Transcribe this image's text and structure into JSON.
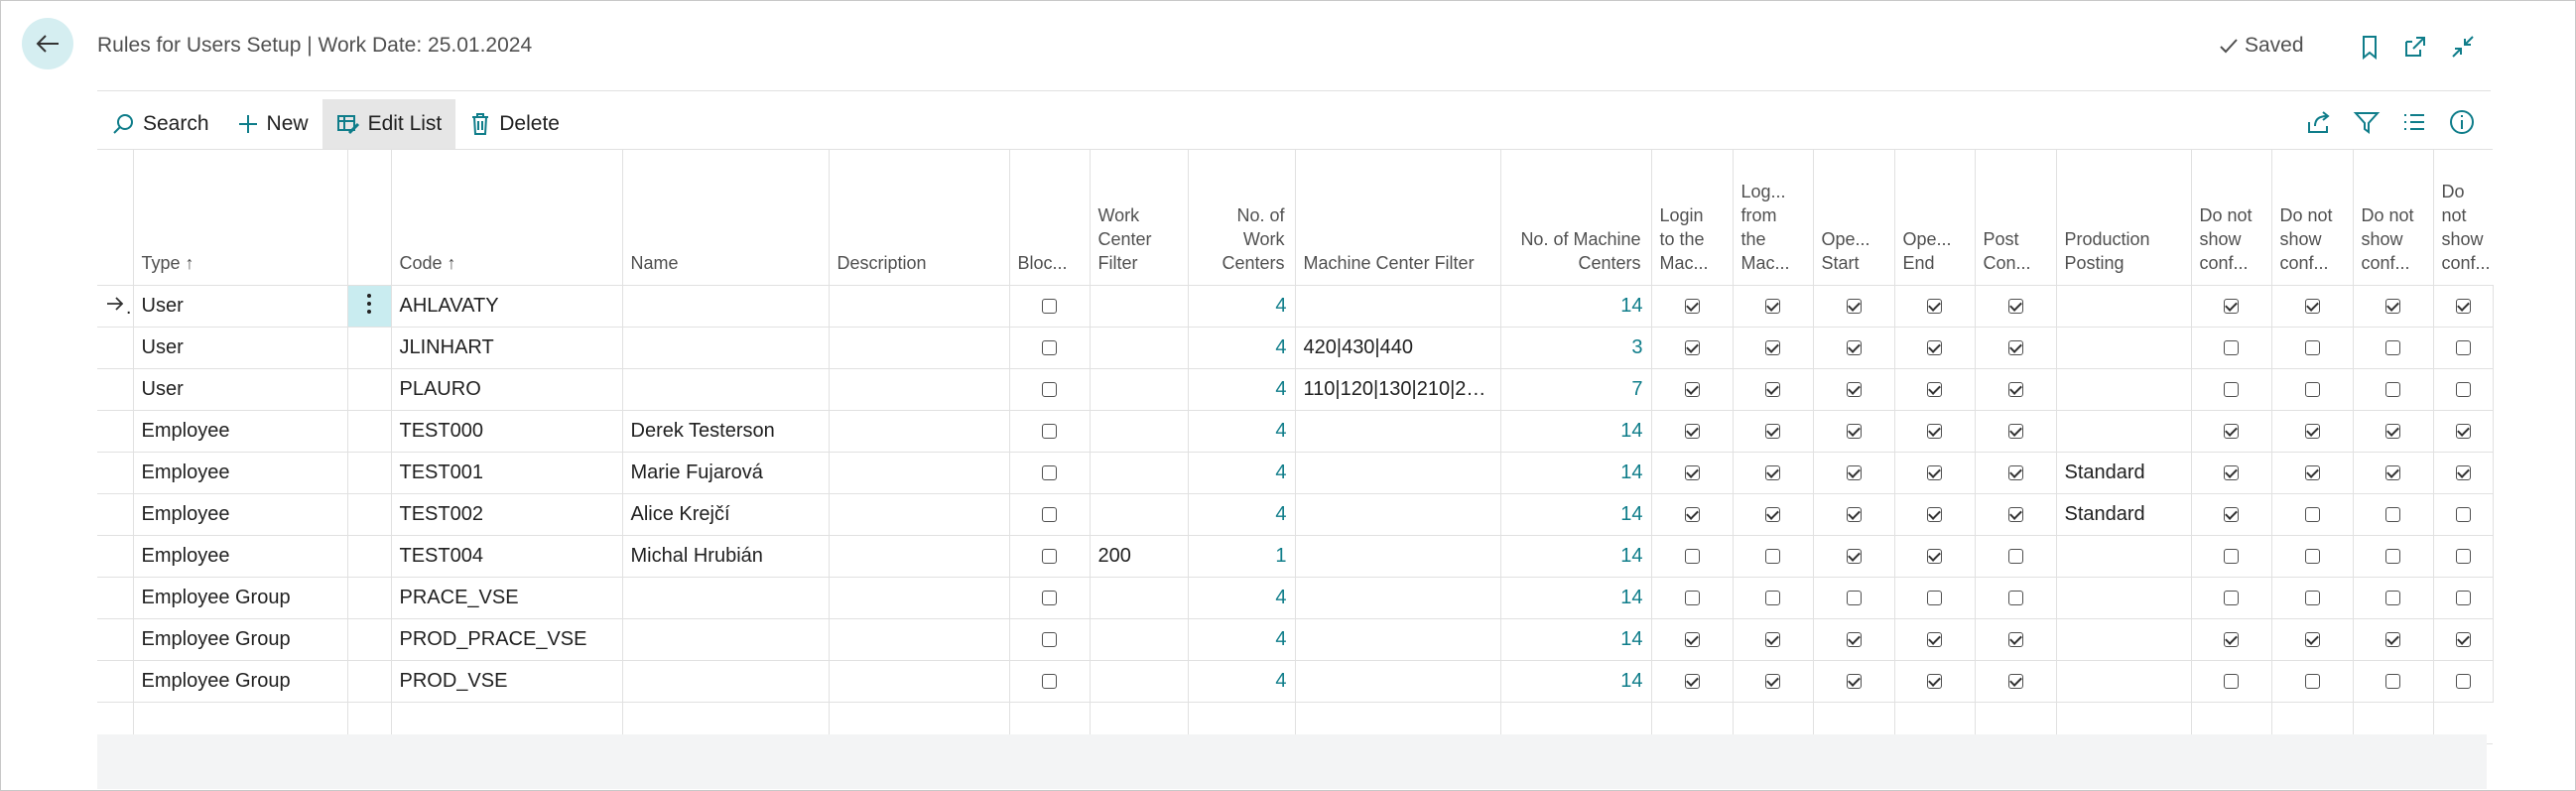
{
  "header": {
    "title": "Rules for Users Setup | Work Date: 25.01.2024",
    "saved_label": "Saved"
  },
  "toolbar": {
    "search_label": "Search",
    "new_label": "New",
    "edit_list_label": "Edit List",
    "delete_label": "Delete"
  },
  "columns": {
    "type": "Type",
    "code": "Code",
    "name": "Name",
    "description": "Description",
    "blocked": "Bloc...",
    "work_center_filter": "Work Center Filter",
    "no_work_centers": "No. of Work Centers",
    "machine_center_filter": "Machine Center Filter",
    "no_machine_centers": "No. of Machine Centers",
    "login": "Login to the Mac...",
    "logout": "Log... from the Mac...",
    "op_start": "Ope... Start",
    "op_end": "Ope... End",
    "post_con": "Post Con...",
    "production_posting": "Production Posting",
    "dns1": "Do not show conf...",
    "dns2": "Do not show conf...",
    "dns3": "Do not show conf...",
    "dns4": "Do not show conf...",
    "sort_arrow": "↑"
  },
  "rows": [
    {
      "type": "User",
      "code": "AHLAVATY",
      "name": "",
      "wcf": "",
      "nwc": "4",
      "mcf": "",
      "nmc": "14",
      "blocked": false,
      "login": true,
      "logout": true,
      "op_start": true,
      "op_end": true,
      "post": true,
      "posting": "",
      "d1": true,
      "d2": true,
      "d3": true,
      "d4": true
    },
    {
      "type": "User",
      "code": "JLINHART",
      "name": "",
      "wcf": "",
      "nwc": "4",
      "mcf": "420|430|440",
      "nmc": "3",
      "blocked": false,
      "login": true,
      "logout": true,
      "op_start": true,
      "op_end": true,
      "post": true,
      "posting": "",
      "d1": false,
      "d2": false,
      "d3": false,
      "d4": false
    },
    {
      "type": "User",
      "code": "PLAURO",
      "name": "",
      "wcf": "",
      "nwc": "4",
      "mcf": "110|120|130|210|22...",
      "nmc": "7",
      "blocked": false,
      "login": true,
      "logout": true,
      "op_start": true,
      "op_end": true,
      "post": true,
      "posting": "",
      "d1": false,
      "d2": false,
      "d3": false,
      "d4": false
    },
    {
      "type": "Employee",
      "code": "TEST000",
      "name": "Derek Testerson",
      "wcf": "",
      "nwc": "4",
      "mcf": "",
      "nmc": "14",
      "blocked": false,
      "login": true,
      "logout": true,
      "op_start": true,
      "op_end": true,
      "post": true,
      "posting": "",
      "d1": true,
      "d2": true,
      "d3": true,
      "d4": true
    },
    {
      "type": "Employee",
      "code": "TEST001",
      "name": "Marie Fujarová",
      "wcf": "",
      "nwc": "4",
      "mcf": "",
      "nmc": "14",
      "blocked": false,
      "login": true,
      "logout": true,
      "op_start": true,
      "op_end": true,
      "post": true,
      "posting": "Standard",
      "d1": true,
      "d2": true,
      "d3": true,
      "d4": true
    },
    {
      "type": "Employee",
      "code": "TEST002",
      "name": "Alice Krejčí",
      "wcf": "",
      "nwc": "4",
      "mcf": "",
      "nmc": "14",
      "blocked": false,
      "login": true,
      "logout": true,
      "op_start": true,
      "op_end": true,
      "post": true,
      "posting": "Standard",
      "d1": true,
      "d2": false,
      "d3": false,
      "d4": false
    },
    {
      "type": "Employee",
      "code": "TEST004",
      "name": "Michal Hrubián",
      "wcf": "200",
      "nwc": "1",
      "mcf": "",
      "nmc": "14",
      "blocked": false,
      "login": false,
      "logout": false,
      "op_start": true,
      "op_end": true,
      "post": false,
      "posting": "",
      "d1": false,
      "d2": false,
      "d3": false,
      "d4": false
    },
    {
      "type": "Employee Group",
      "code": "PRACE_VSE",
      "name": "",
      "wcf": "",
      "nwc": "4",
      "mcf": "",
      "nmc": "14",
      "blocked": false,
      "login": false,
      "logout": false,
      "op_start": false,
      "op_end": false,
      "post": false,
      "posting": "",
      "d1": false,
      "d2": false,
      "d3": false,
      "d4": false
    },
    {
      "type": "Employee Group",
      "code": "PROD_PRACE_VSE",
      "name": "",
      "wcf": "",
      "nwc": "4",
      "mcf": "",
      "nmc": "14",
      "blocked": false,
      "login": true,
      "logout": true,
      "op_start": true,
      "op_end": true,
      "post": true,
      "posting": "",
      "d1": true,
      "d2": true,
      "d3": true,
      "d4": true
    },
    {
      "type": "Employee Group",
      "code": "PROD_VSE",
      "name": "",
      "wcf": "",
      "nwc": "4",
      "mcf": "",
      "nmc": "14",
      "blocked": false,
      "login": true,
      "logout": true,
      "op_start": true,
      "op_end": true,
      "post": true,
      "posting": "",
      "d1": false,
      "d2": false,
      "d3": false,
      "d4": false
    }
  ],
  "colors": {
    "accent": "#0f7d8a",
    "selected_cell": "#c9ecf0",
    "back_button": "#d5eef1"
  }
}
